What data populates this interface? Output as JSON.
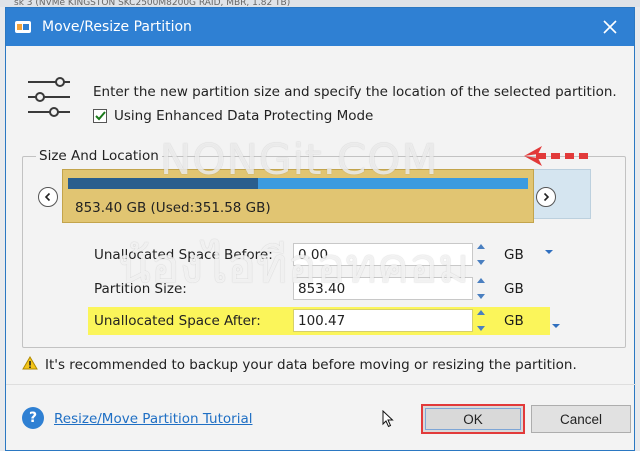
{
  "background": {
    "title": "sk 3 (NVMe KINGSTON SKC2500M8200G RAID, MBR, 1.82 TB)"
  },
  "dialog": {
    "title": "Move/Resize Partition",
    "intro_text": "Enter the new partition size and specify the location of the selected partition.",
    "protect_mode_label": "Using Enhanced Data Protecting Mode",
    "protect_mode_checked": true
  },
  "size_location": {
    "group_label": "Size And Location",
    "partition_label": "853.40 GB (Used:351.58 GB)",
    "used_fraction": 0.412
  },
  "fields": [
    {
      "label": "Unallocated Space Before:",
      "value": "0.00",
      "unit": "GB"
    },
    {
      "label": "Partition Size:",
      "value": "853.40",
      "unit": "GB"
    },
    {
      "label": "Unallocated Space After:",
      "value": "100.47",
      "unit": "GB"
    }
  ],
  "warning_text": "It's recommended to backup your data before moving or resizing the partition.",
  "footer": {
    "tutorial_link": "Resize/Move Partition Tutorial",
    "ok_label": "OK",
    "cancel_label": "Cancel"
  },
  "watermark": {
    "line1": "NONGit.COM",
    "line2": "น้องไอทีออทคอม"
  },
  "colors": {
    "titlebar": "#2f80d3",
    "partition": "#e1c572",
    "used": "#2a5e8d",
    "free": "#3c9be0",
    "highlight": "#fbf55a",
    "ok_outline": "#e23a3a",
    "arrow": "#e23a3a"
  }
}
